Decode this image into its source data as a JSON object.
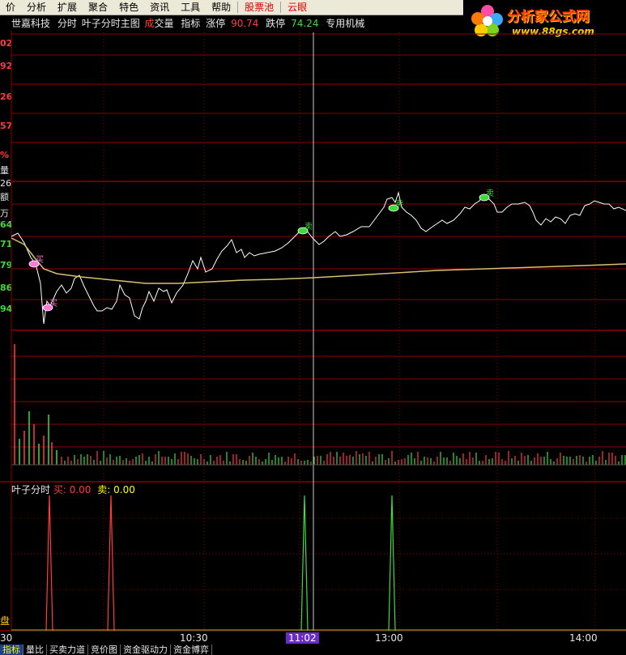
{
  "menu": {
    "items": [
      {
        "label": "价",
        "highlight": false
      },
      {
        "label": "分析",
        "highlight": false
      },
      {
        "label": "扩展",
        "highlight": false
      },
      {
        "label": "聚合",
        "highlight": false
      },
      {
        "label": "特色",
        "highlight": false
      },
      {
        "label": "资讯",
        "highlight": false
      },
      {
        "label": "工具",
        "highlight": false
      },
      {
        "label": "帮助",
        "highlight": false
      },
      {
        "label": "股票池",
        "highlight": true
      },
      {
        "label": "云眼",
        "highlight": true
      }
    ]
  },
  "logo": {
    "brand": "分析家公式网",
    "url": "www.88gs.com"
  },
  "info": {
    "stock_name": "世嘉科技",
    "view": "分时",
    "indicator_title": "叶子分时主图",
    "volume_label_a": "成",
    "volume_label_b": "交量",
    "index_label": "指标",
    "limit_up_label": "涨停",
    "limit_up_value": "90.74",
    "limit_down_label": "跌停",
    "limit_down_value": "74.24",
    "sector": "专用机械"
  },
  "left_axis": [
    {
      "text": "02",
      "cls": "axis-num"
    },
    {
      "text": "92",
      "cls": "axis-num"
    },
    {
      "text": "26",
      "cls": "axis-num"
    },
    {
      "text": "57",
      "cls": "axis-num"
    },
    {
      "text": "%",
      "cls": "axis-num"
    },
    {
      "text": "量",
      "cls": "axis-num w"
    },
    {
      "text": "26",
      "cls": "axis-num w"
    },
    {
      "text": "额",
      "cls": "axis-num w"
    },
    {
      "text": "万",
      "cls": "axis-num w"
    },
    {
      "text": "64",
      "cls": "axis-num g"
    },
    {
      "text": "71",
      "cls": "axis-num g"
    },
    {
      "text": "79",
      "cls": "axis-num g"
    },
    {
      "text": "86",
      "cls": "axis-num g"
    },
    {
      "text": "94",
      "cls": "axis-num g"
    }
  ],
  "indicator": {
    "name": "叶子分时",
    "buy_label": "买:",
    "buy_value": "0.00",
    "sell_label": "卖:",
    "sell_value": "0.00",
    "corner_label": "盘"
  },
  "chart_markers": {
    "buy": "买",
    "sell": "卖"
  },
  "time_axis": {
    "start": "30",
    "labels": [
      "10:30",
      "11:02",
      "13:00",
      "14:00"
    ],
    "active": "11:02"
  },
  "tabs": [
    {
      "label": "指标",
      "active": true
    },
    {
      "label": "量比",
      "active": false
    },
    {
      "label": "买卖力道",
      "active": false
    },
    {
      "label": "竞价图",
      "active": false
    },
    {
      "label": "资金驱动力",
      "active": false
    },
    {
      "label": "资金博弈",
      "active": false
    }
  ],
  "colors": {
    "price_line": "#ffffff",
    "avg_line": "#d8c070",
    "grid": "#8c0000",
    "up": "#ff3c3c",
    "down": "#3cdc3c",
    "cursor": "#cccccc"
  },
  "chart_data": {
    "type": "line",
    "title": "叶子分时主图",
    "limit_up": 90.74,
    "limit_down": 74.24,
    "buy_signal_times": [
      "09:41",
      "10:01"
    ],
    "sell_signal_times": [
      "10:56",
      "11:18",
      "13:24"
    ]
  }
}
